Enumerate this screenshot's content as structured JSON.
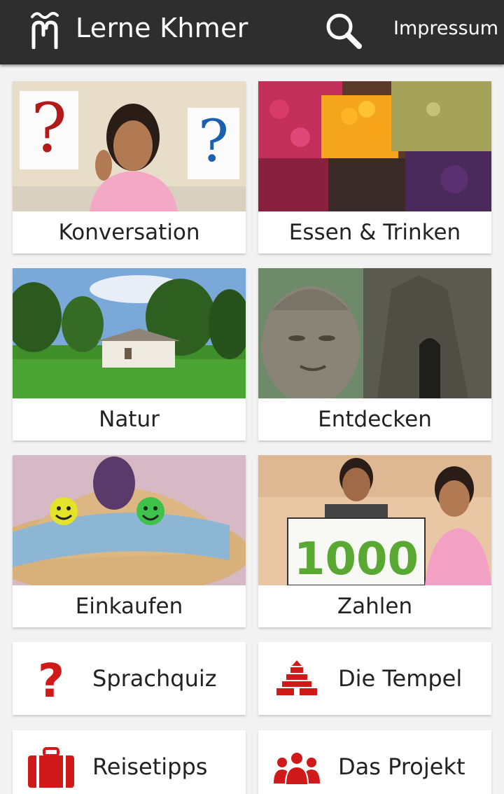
{
  "header": {
    "title": "Lerne Khmer",
    "impressum": "Impressum",
    "logo_icon": "khmer-letter-logo",
    "search_icon": "search-icon"
  },
  "categories": [
    {
      "label": "Konversation",
      "image": "girl-thinking-question-marks"
    },
    {
      "label": "Essen & Trinken",
      "image": "fruit-market-stall"
    },
    {
      "label": "Natur",
      "image": "rice-field-house-palms"
    },
    {
      "label": "Entdecken",
      "image": "stone-face-temple"
    },
    {
      "label": "Einkaufen",
      "image": "straw-hat-smiley-buttons"
    },
    {
      "label": "Zahlen",
      "image": "kids-holding-1000-sign",
      "sign_text": "1000"
    }
  ],
  "buttons": [
    {
      "label": "Sprachquiz",
      "icon": "question-mark-icon"
    },
    {
      "label": "Die Tempel",
      "icon": "temple-icon"
    },
    {
      "label": "Reisetipps",
      "icon": "suitcase-icon"
    },
    {
      "label": "Das Projekt",
      "icon": "people-group-icon"
    }
  ],
  "colors": {
    "header_bg": "#2e2e2e",
    "accent_red": "#d01a1a",
    "background": "#f2f2f2"
  }
}
